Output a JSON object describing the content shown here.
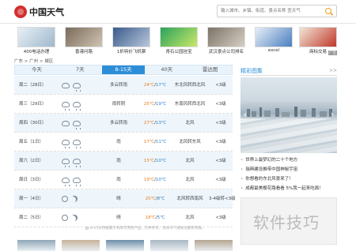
{
  "header": {
    "logo_text": "中国天气",
    "search_placeholder": "输入城市、乡镇、街道、景点名称 查天气"
  },
  "thumbs": [
    {
      "caption": "400电话办理",
      "colors": [
        "#e8f0f6",
        "#9fb8cc"
      ]
    },
    {
      "caption": "香港问路",
      "colors": [
        "#7b6a5a",
        "#cfc4b3"
      ]
    },
    {
      "caption": "1折特价飞机票",
      "colors": [
        "#3a5a8a",
        "#b9c7db"
      ]
    },
    {
      "caption": "青石公园挂宝",
      "colors": [
        "#2aa35a",
        "#cbe86a"
      ]
    },
    {
      "caption": "武汉景点公司排名",
      "colors": [
        "#7c7368",
        "#d7cfc4"
      ]
    },
    {
      "caption": "excel",
      "colors": [
        "#e7eef7",
        "#4b7fbf"
      ]
    },
    {
      "caption": "商标交易",
      "colors": [
        "#f2e6d6",
        "#c0392b"
      ]
    }
  ],
  "ad_badge": "广告",
  "breadcrumb": "广东 > 广州 > 城区",
  "tabs": [
    {
      "label": "今天",
      "active": false
    },
    {
      "label": "7天",
      "active": false
    },
    {
      "label": "8-15天",
      "active": true
    },
    {
      "label": "40天",
      "active": false
    },
    {
      "label": "雷达图",
      "active": false
    }
  ],
  "forecast": [
    {
      "date": "周二（28日）",
      "icons": [
        "cloud",
        "cloud-rain"
      ],
      "cond": "多云转雨",
      "high": "24℃",
      "low": "17℃",
      "wind": "东北风转西北风",
      "level": "<3级"
    },
    {
      "date": "周三（29日）",
      "icons": [
        "cloud-rain",
        "cloud-rain"
      ],
      "cond": "雨转阴",
      "high": "25℃",
      "low": "19℃",
      "wind": "东南风转西北风",
      "level": "<3级"
    },
    {
      "date": "周四（30日）",
      "icons": [
        "cloud",
        "cloud-rain"
      ],
      "cond": "多云转雨",
      "high": "27℃",
      "low": "13℃",
      "wind": "北风",
      "level": "<3级"
    },
    {
      "date": "周五（1日）",
      "icons": [
        "cloud-rain",
        "cloud-rain"
      ],
      "cond": "雨",
      "high": "17℃",
      "low": "11℃",
      "wind": "北风转东风",
      "level": "<3级"
    },
    {
      "date": "周六（2日）",
      "icons": [
        "cloud-rain",
        "cloud-rain"
      ],
      "cond": "雨",
      "high": "15℃",
      "low": "10℃",
      "wind": "北风",
      "level": "<3级"
    },
    {
      "date": "周日（3日）",
      "icons": [
        "cloud-rain",
        "cloud-rain"
      ],
      "cond": "雨",
      "high": "19℃",
      "low": "10℃",
      "wind": "北风",
      "level": "<3级"
    },
    {
      "date": "周一（4日）",
      "icons": [
        "sun",
        "moon"
      ],
      "cond": "晴",
      "high": "20℃",
      "low": "8℃",
      "wind": "北风转西南风",
      "level": "3-4级转<3级"
    },
    {
      "date": "周二（5日）",
      "icons": [
        "sun",
        "moon"
      ],
      "cond": "晴",
      "high": "18℃",
      "low": "5℃",
      "wind": "北风",
      "level": "<3级"
    }
  ],
  "footnote": "8-15天预报属于有限可用性产品，仅供参考，具体天气请关注最新预报。",
  "side": {
    "title": "精彩图集",
    "more": ">>",
    "news": [
      "世界上最梦幻的二十个地方",
      "瑞典建设推带中国神秘宇宙",
      "你想看的东北风景来了！",
      "成都最美樱花路看看 5%我一起来吃面！"
    ]
  },
  "watermark": "软件技巧",
  "colors": {
    "accent": "#2d8ed8",
    "high_temp": "#e57c1f",
    "low_temp": "#2a7fc9"
  }
}
